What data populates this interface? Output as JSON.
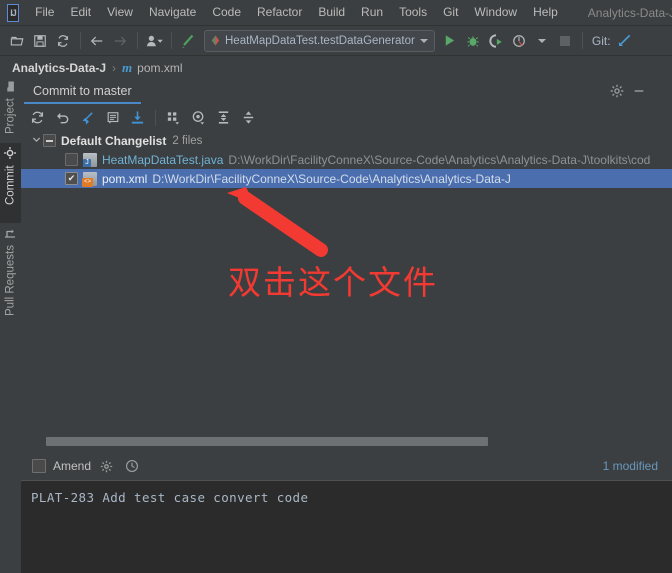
{
  "window": {
    "title": "Analytics-Data-J - HeatM"
  },
  "menubar": {
    "logo": "IJ",
    "items": [
      {
        "label": "File"
      },
      {
        "label": "Edit"
      },
      {
        "label": "View"
      },
      {
        "label": "Navigate"
      },
      {
        "label": "Code"
      },
      {
        "label": "Refactor"
      },
      {
        "label": "Build"
      },
      {
        "label": "Run"
      },
      {
        "label": "Tools"
      },
      {
        "label": "Git"
      },
      {
        "label": "Window"
      },
      {
        "label": "Help"
      }
    ]
  },
  "toolbar": {
    "open_icon": "open-folder-icon",
    "save_icon": "save-icon",
    "sync_icon": "sync-icon",
    "back_icon": "back-arrow-icon",
    "forward_icon": "forward-arrow-icon",
    "profile_icon": "user-profile-icon",
    "build_icon": "build-hammer-icon",
    "run_config": "HeatMapDataTest.testDataGenerator",
    "run_icon": "run-play-icon",
    "debug_icon": "debug-bug-icon",
    "coverage_icon": "run-with-coverage-icon",
    "profiler_icon": "profiler-icon",
    "stop_icon": "stop-icon",
    "git_label": "Git:",
    "update_icon": "vcs-update-icon"
  },
  "breadcrumb": {
    "project": "Analytics-Data-J",
    "separator": "›",
    "file_badge": "m",
    "file": "pom.xml"
  },
  "left_tool_strip": {
    "items": [
      {
        "label": "Project",
        "icon": "project-folder-icon",
        "active": false
      },
      {
        "label": "Commit",
        "icon": "commit-icon",
        "active": true
      },
      {
        "label": "Pull Requests",
        "icon": "pull-request-icon",
        "active": false
      }
    ]
  },
  "commit_window": {
    "tab_label": "Commit to master",
    "settings_icon": "gear-icon",
    "hide_icon": "minimize-icon",
    "toolbar_icons": [
      {
        "name": "refresh-changes-icon",
        "glyph": "↻"
      },
      {
        "name": "rollback-icon",
        "glyph": "↩"
      },
      {
        "name": "shelve-silently-icon",
        "glyph": "✦"
      },
      {
        "name": "show-diff-icon",
        "glyph": "▤"
      },
      {
        "name": "get-from-vcs-icon",
        "glyph": "⤓"
      },
      {
        "name": "group-by-icon",
        "glyph": "∷"
      },
      {
        "name": "preview-diff-icon",
        "glyph": "◎"
      },
      {
        "name": "expand-all-icon",
        "glyph": "⨌"
      },
      {
        "name": "collapse-all-icon",
        "glyph": "⨍"
      }
    ],
    "changelist": {
      "name": "Default Changelist",
      "file_count": "2 files",
      "checkbox_state": "partial",
      "expanded": true
    },
    "files": [
      {
        "name": "HeatMapDataTest.java",
        "path": "D:\\WorkDir\\FacilityConneX\\Source-Code\\Analytics\\Analytics-Data-J\\toolkits\\cod",
        "icon": "java-file-icon",
        "checked": false,
        "selected": false
      },
      {
        "name": "pom.xml",
        "path": "D:\\WorkDir\\FacilityConneX\\Source-Code\\Analytics\\Analytics-Data-J",
        "icon": "xml-file-icon",
        "checked": true,
        "selected": true
      }
    ],
    "amend": {
      "label": "Amend",
      "checked": false,
      "settings_icon": "commit-options-gear-icon",
      "history_icon": "commit-history-clock-icon"
    },
    "status": "1 modified",
    "commit_message": "PLAT-283 Add test case convert code"
  },
  "annotation": {
    "text": "双击这个文件",
    "color": "#f33a32",
    "arrow": "red-arrow-pointing-up-left"
  },
  "colors": {
    "background": "#3c3f41",
    "editor_background": "#2b2b2b",
    "selection_blue": "#4b6eaf",
    "accent_blue": "#4a88c7",
    "link_blue": "#6897bb",
    "text": "#bbbbbb"
  }
}
